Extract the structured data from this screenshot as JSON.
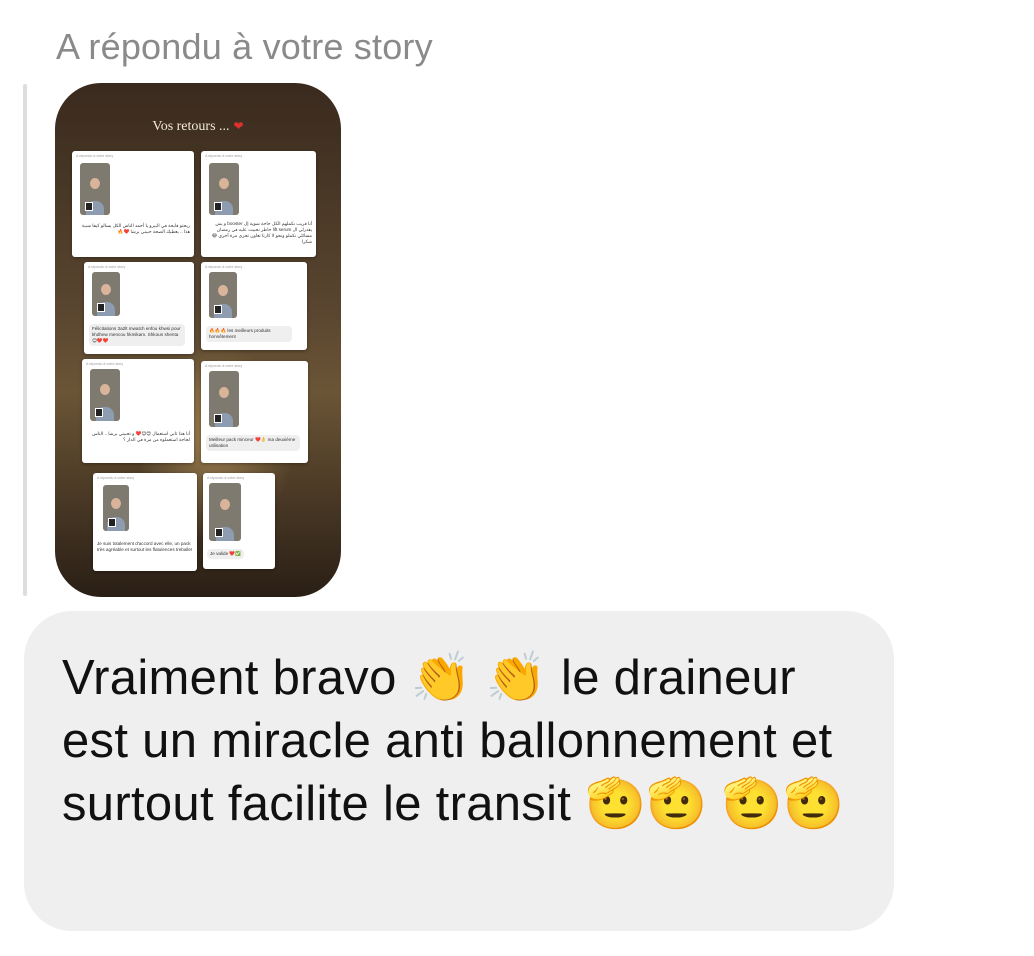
{
  "reply_header": "A répondu à votre story",
  "story": {
    "title": "Vos retours ...",
    "heart": "❤",
    "card_header": "A répondu à votre story",
    "cards": [
      {
        "text": "ريحتو فايحة في البيرو يا أحمد الناس الكل يسالو كيفا شبية هذا .. يعطيك الصحة حبيني برشا ❤️🔥"
      },
      {
        "text": "أنا قريب نكملهم الكل حاجة شوية إل booster و بش يقدرلي ال lift serum خاطر نحبيت عليه في رمضان مسائلي نكملو ونحو لا كارتا تعاون تحري مرة أخرى 😂 شكرا"
      },
      {
        "text": "Félicitations 3a2lt mwatch enfou khwsi pour khdhew mencou hkmikam. Shkoun shenta 😊❤️❤️"
      },
      {
        "text": "🔥🔥🔥 les meilleurs produits honnêtement"
      },
      {
        "text": "أنا هذا ثاني استعمال 😍😊❤️ و تحبيني برشا .. الناس لحاجة استعملوه من مرة في الدار ؟"
      },
      {
        "text": "Meilleur pack minceur ❤️👌 ma deuxième utilisation"
      },
      {
        "text": "Je suis totalement d'accord avec elle, un pack très agréable et surtout les flatulences treballe!"
      },
      {
        "text": "Je valide ❤️✅"
      }
    ]
  },
  "message": {
    "text": "Vraiment bravo 👏 👏 le draineur est un miracle anti ballonnement et surtout facilite le transit 🫡🫡 🫡🫡"
  }
}
